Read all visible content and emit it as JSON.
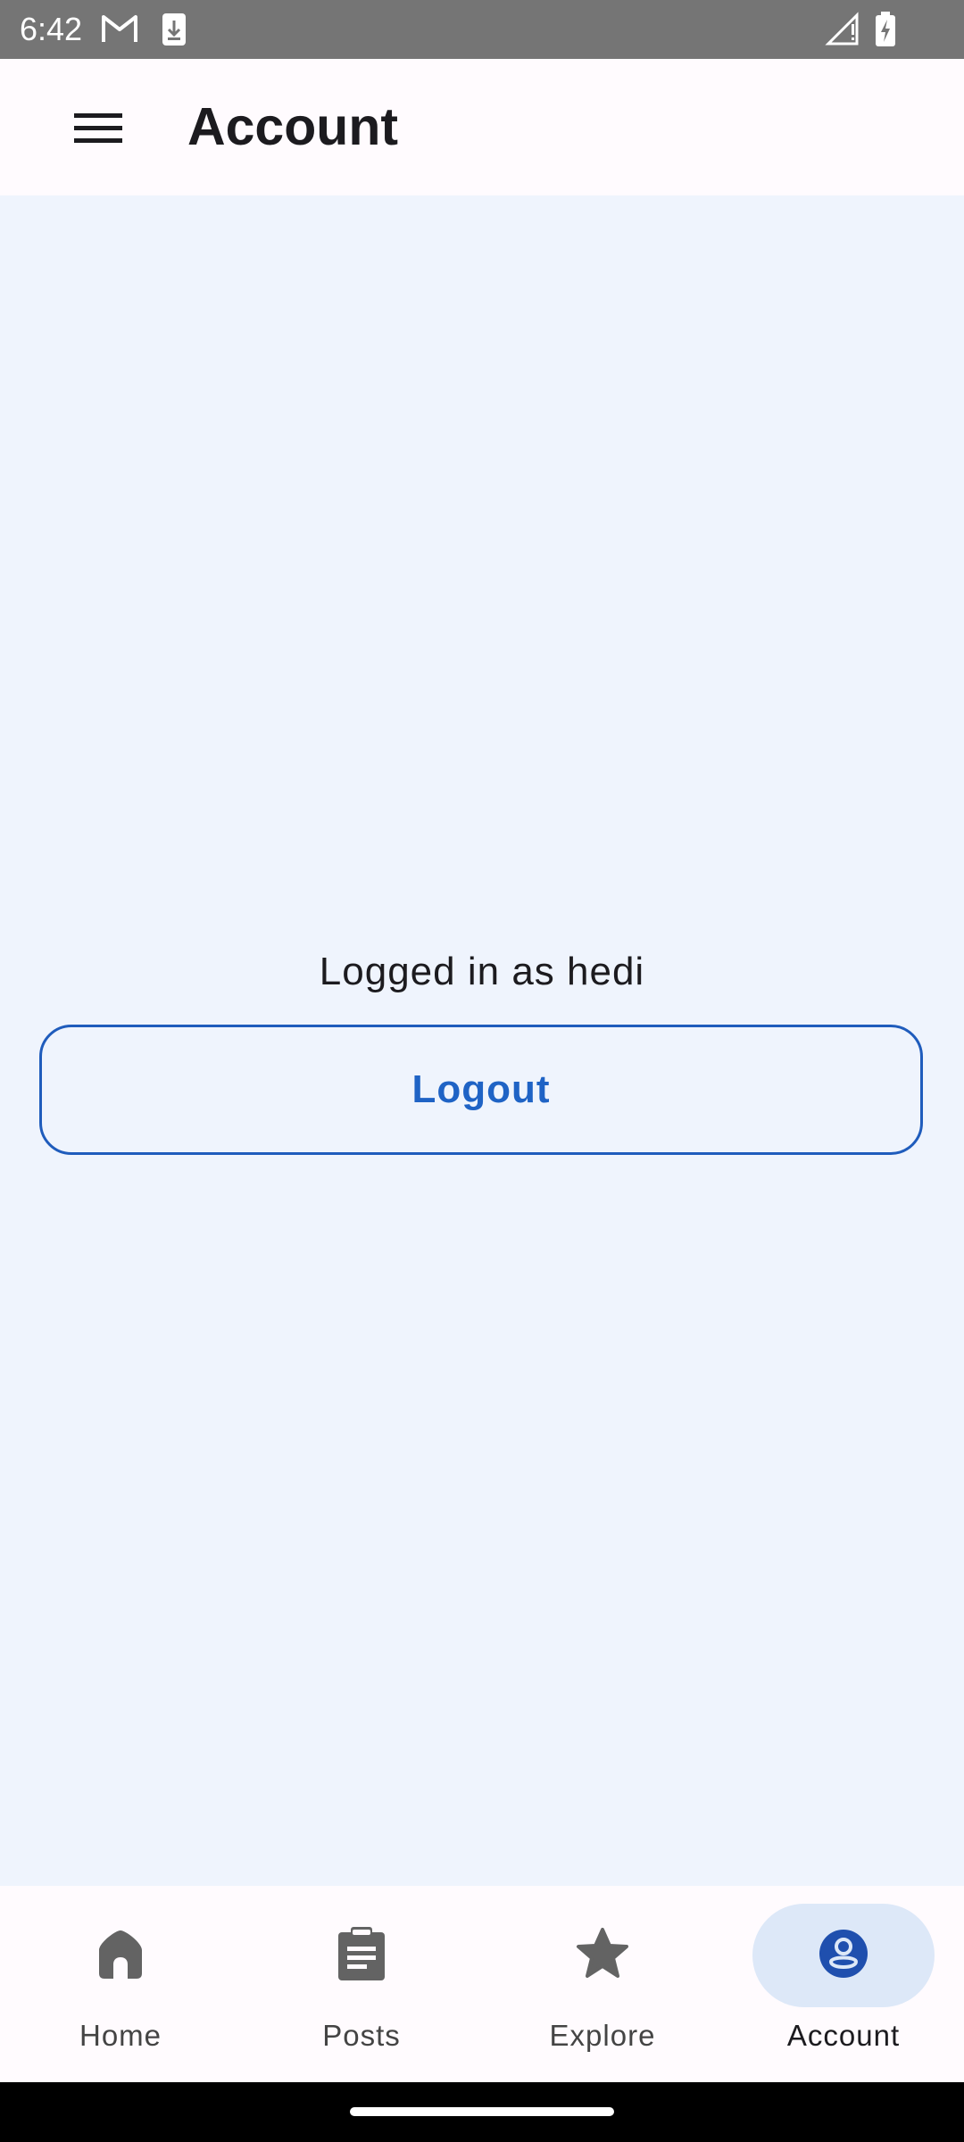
{
  "status_bar": {
    "time": "6:42",
    "icons": [
      "gmail-icon",
      "download-icon",
      "signal-icon",
      "battery-charging-icon"
    ]
  },
  "app_bar": {
    "title": "Account",
    "menu_icon": "menu-icon"
  },
  "main": {
    "logged_in_text": "Logged in as hedi",
    "logout_label": "Logout"
  },
  "bottom_nav": {
    "items": [
      {
        "label": "Home",
        "icon": "home-icon",
        "active": false
      },
      {
        "label": "Posts",
        "icon": "posts-icon",
        "active": false
      },
      {
        "label": "Explore",
        "icon": "star-icon",
        "active": false
      },
      {
        "label": "Account",
        "icon": "account-icon",
        "active": true
      }
    ]
  },
  "colors": {
    "accent": "#1f63c5",
    "content_bg": "#eff4fd",
    "active_pill": "#dde8f8",
    "status_bar": "#757575"
  }
}
